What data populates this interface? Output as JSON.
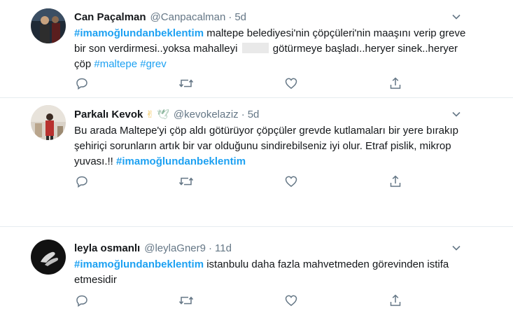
{
  "colors": {
    "link": "#1da1f2",
    "secondary": "#657786",
    "text": "#14171a",
    "divider": "#e6ecf0"
  },
  "tweets": [
    {
      "name": "Can Paçalman",
      "handle": "@Canpacalman",
      "dot": "·",
      "time": "5d",
      "hashtag": "#imamoğlundanbeklentim",
      "text_a": " maltepe belediyesi'nin çöpçüleri'nin maaşını verip greve bir son verdirmesi..yoksa mahalleyi ",
      "text_b": " götürmeye başladı..heryer sinek..heryer çöp ",
      "tag2": "#maltepe",
      "tag3": "#grev"
    },
    {
      "name": "Parkalı Kevok",
      "emoji1": "✌",
      "emoji2": "🕊",
      "handle": "@kevokelaziz",
      "dot": "·",
      "time": "5d",
      "text": "Bu arada Maltepe'yi çöp aldı götürüyor çöpçüler grevde kutlamaları bir yere bırakıp şehiriçi sorunların artık bir var olduğunu sindirebilseniz iyi olur. Etraf pislik, mikrop yuvası.!! ",
      "hashtag": "#imamoğlundanbeklentim"
    },
    {
      "name": "leyla osmanlı",
      "handle": "@leylaGner9",
      "dot": "·",
      "time": "11d",
      "hashtag": "#imamoğlundanbeklentim",
      "text": " istanbulu daha fazla mahvetmeden görevinden istifa etmesidir"
    }
  ],
  "icons": {
    "reply": "reply-icon",
    "retweet": "retweet-icon",
    "like": "like-icon",
    "share": "share-icon",
    "caret": "chevron-down-icon"
  }
}
